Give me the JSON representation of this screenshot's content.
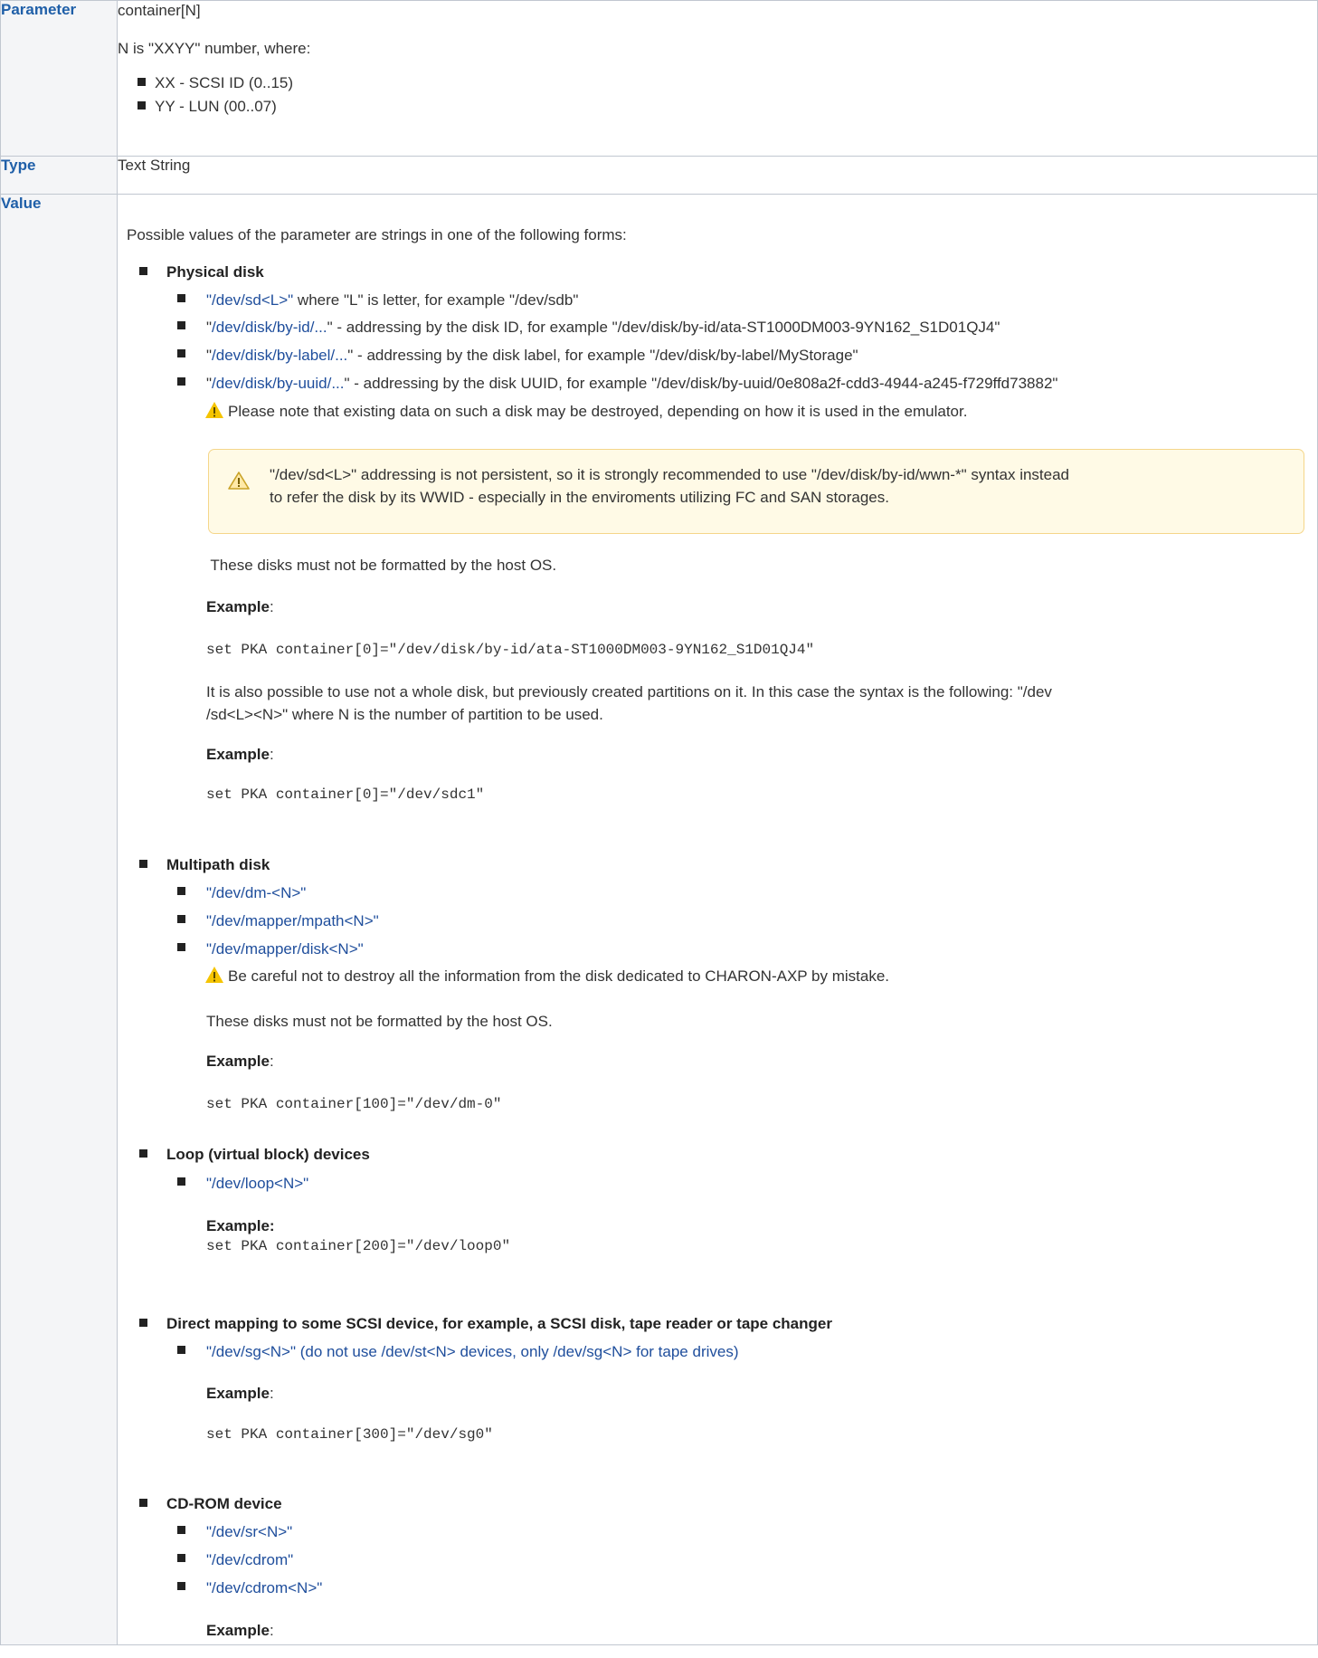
{
  "labels": {
    "parameter": "Parameter",
    "type": "Type",
    "value": "Value"
  },
  "parameter": {
    "name": "container[N]",
    "description": "N is \"XXYY\" number, where:",
    "items": [
      "XX - SCSI ID (0..15)",
      "YY - LUN (00..07)"
    ]
  },
  "type": {
    "value": "Text String"
  },
  "value": {
    "intro": "Possible values of the parameter are strings in one of the following forms:",
    "physical": {
      "heading": "Physical disk",
      "items": [
        {
          "link": "\"/dev/sd<L>\"",
          "text": " where \"L\" is letter, for example \"/dev/sdb\""
        },
        {
          "pre": "\"",
          "link": "/dev/disk/by-id/...",
          "text": "\" - addressing by the disk ID, for example \"/dev/disk/by-id/ata-ST1000DM003-9YN162_S1D01QJ4\""
        },
        {
          "pre": "\"",
          "link": "/dev/disk/by-label/...",
          "text": "\" - addressing by the disk label, for example \"/dev/disk/by-label/MyStorage\""
        },
        {
          "pre": "\"",
          "link": "/dev/disk/by-uuid/...",
          "text": "\" - addressing by the disk UUID, for example \"/dev/disk/by-uuid/0e808a2f-cdd3-4944-a245-f729ffd73882\""
        }
      ],
      "warning": "Please note that existing data on such a disk may be destroyed, depending on how it is used in the emulator.",
      "note_line1": "\"/dev/sd<L>\" addressing is not persistent, so it is strongly recommended to use \"/dev/disk/by-id/wwn-*\" syntax instead",
      "note_line2": "to refer the disk by its WWID - especially in the enviroments utilizing FC and SAN storages.",
      "not_formatted": " These disks must not be formatted by the host OS.",
      "example_label": "Example",
      "example_colon": ":",
      "example_code": "set PKA container[0]=\"/dev/disk/by-id/ata-ST1000DM003-9YN162_S1D01QJ4\"",
      "partitions_line1": "It is also possible to use not a whole disk, but previously created partitions on it. In this case the syntax is the following: \"/dev",
      "partitions_line2": "/sd<L><N>\" where N is the number of partition to be used.",
      "example2_code": "set PKA container[0]=\"/dev/sdc1\""
    },
    "multipath": {
      "heading": "Multipath disk",
      "items": [
        "\"/dev/dm-<N>\"",
        "\"/dev/mapper/mpath<N>\"",
        "\"/dev/mapper/disk<N>\""
      ],
      "warning": "Be careful not to destroy all the information from the disk dedicated to CHARON-AXP by mistake.",
      "not_formatted": "These disks must not be formatted by the host OS.",
      "example_code": "set PKA container[100]=\"/dev/dm-0\""
    },
    "loop": {
      "heading": "Loop (virtual block) devices",
      "items": [
        "\"/dev/loop<N>\""
      ],
      "example_label": "Example:",
      "example_code": "set PKA container[200]=\"/dev/loop0\""
    },
    "direct": {
      "heading": "Direct mapping to some SCSI device, for example, a SCSI disk, tape reader or tape changer",
      "items": [
        "\"/dev/sg<N>\" (do not use /dev/st<N> devices, only /dev/sg<N> for tape drives)"
      ],
      "example_code": "set PKA container[300]=\"/dev/sg0\""
    },
    "cdrom": {
      "heading": "CD-ROM device",
      "items": [
        "\"/dev/sr<N>\"",
        "\"/dev/cdrom\"",
        "\"/dev/cdrom<N>\""
      ]
    }
  },
  "colors": {
    "link": "#1f4e9c",
    "header_text": "#1f5fa8",
    "header_bg": "#f4f5f7",
    "border": "#c1c7d0",
    "note_bg": "#fffae6",
    "warning": "#f5c400"
  }
}
